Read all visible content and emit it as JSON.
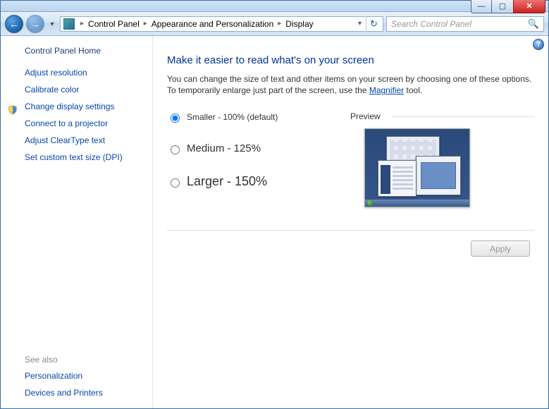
{
  "window": {
    "min_glyph": "—",
    "max_glyph": "▢",
    "close_glyph": "✕"
  },
  "nav": {
    "back_glyph": "←",
    "forward_glyph": "→",
    "history_glyph": "▼",
    "refresh_glyph": "↻",
    "address_dropdown_glyph": "▾"
  },
  "breadcrumb": {
    "item1": "Control Panel",
    "item2": "Appearance and Personalization",
    "item3": "Display",
    "sep": "▸"
  },
  "search": {
    "placeholder": "Search Control Panel",
    "icon": "🔍"
  },
  "sidebar": {
    "home": "Control Panel Home",
    "links": {
      "adjust_resolution": "Adjust resolution",
      "calibrate_color": "Calibrate color",
      "change_display_settings": "Change display settings",
      "connect_projector": "Connect to a projector",
      "adjust_cleartype": "Adjust ClearType text",
      "set_dpi": "Set custom text size (DPI)"
    },
    "see_also_heading": "See also",
    "see_also": {
      "personalization": "Personalization",
      "devices_printers": "Devices and Printers"
    }
  },
  "main": {
    "help_glyph": "?",
    "title": "Make it easier to read what's on your screen",
    "description_pre": "You can change the size of text and other items on your screen by choosing one of these options. To temporarily enlarge just part of the screen, use the ",
    "magnifier_link": "Magnifier",
    "description_post": " tool.",
    "options": {
      "smaller": "Smaller - 100% (default)",
      "medium": "Medium - 125%",
      "larger": "Larger - 150%",
      "selected": "smaller"
    },
    "preview_label": "Preview",
    "apply_label": "Apply",
    "apply_enabled": false
  }
}
